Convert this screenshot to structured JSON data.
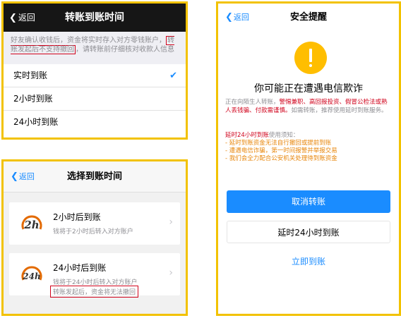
{
  "panel1": {
    "back_label": "返回",
    "title": "转账到账时间",
    "note_before": "好友确认收钱后，资金将实时存入对方零钱账户，",
    "note_boxed": "转账发起后不支持撤回",
    "note_after": "，请转账前仔细核对收款人信息",
    "options": [
      {
        "label": "实时到账",
        "selected": true
      },
      {
        "label": "2小时到账",
        "selected": false
      },
      {
        "label": "24小时到账",
        "selected": false
      }
    ]
  },
  "panel2": {
    "back_label": "返回",
    "title": "选择到账时间",
    "cards": [
      {
        "logo_text": "2h",
        "title": "2小时后到账",
        "subtitle": "钱将于2小时后转入对方账户"
      },
      {
        "logo_text": "24h",
        "title": "24小时后到账",
        "subtitle": "钱将于24小时后转入对方账户"
      }
    ],
    "footer_warning": "转账发起后，资金将无法撤回"
  },
  "panel3": {
    "back_label": "返回",
    "title": "安全提醒",
    "headline": "你可能正在遭遇电信欺诈",
    "desc_before": "正在向陌生人转账，",
    "desc_red": "警惕兼职、高回报投资、假冒公检法或熟人丢钱骗、付款需谨慎。",
    "desc_after": "如需转账，推荐使用延时到账服务。",
    "delay_lead": "延时24小时到账",
    "delay_intro": "使用须知：",
    "delay_items": [
      "- 延时到账资金无法自行撤回或提前到账",
      "- 遭遇电信诈骗，第一时间报警并举报交易",
      "- 我们会全力配合公安机关处理待到账资金"
    ],
    "cancel_button": "取消转账",
    "delay_button": "延时24小时到账",
    "now_button": "立即到账"
  },
  "colors": {
    "frame": "#f2c200",
    "accent_blue": "#1a8cff",
    "warning_red": "#d0021b",
    "warning_orange": "#e8870c",
    "warning_icon": "#ffbe00",
    "logo_orange": "#e36a00"
  },
  "icons": {
    "back": "chevron-left-icon",
    "check": "checkmark-icon",
    "warning": "exclamation-circle-icon",
    "card_arrow": "chevron-right-icon"
  }
}
